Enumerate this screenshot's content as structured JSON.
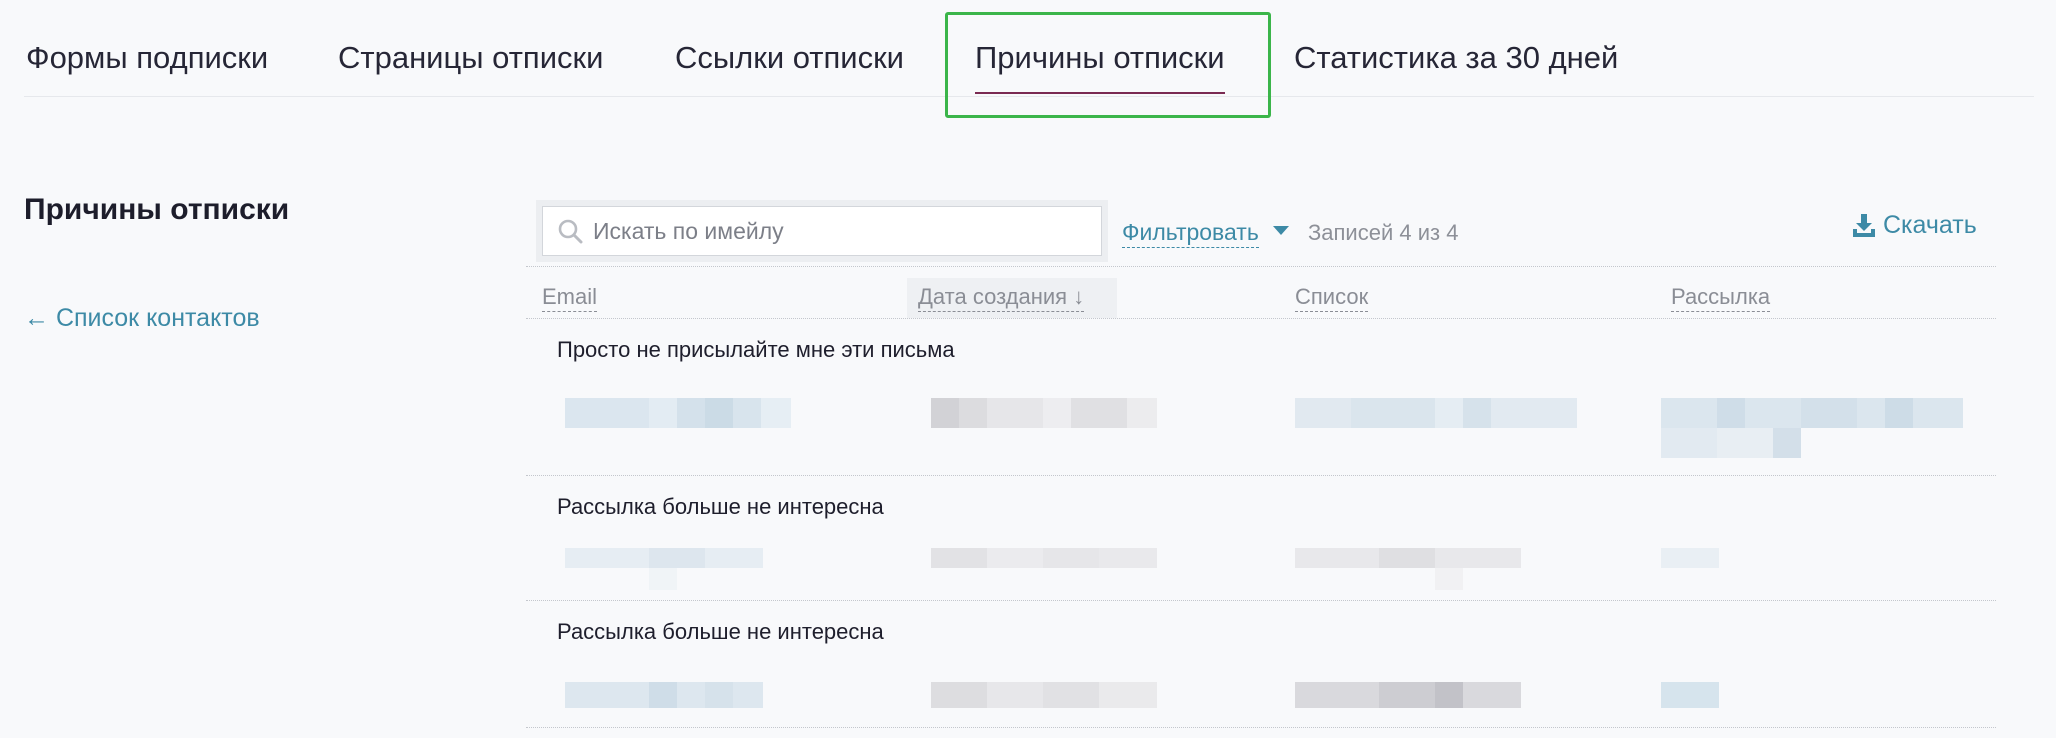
{
  "tabs": [
    {
      "label": "Формы подписки",
      "active": false
    },
    {
      "label": "Страницы отписки",
      "active": false
    },
    {
      "label": "Ссылки отписки",
      "active": false
    },
    {
      "label": "Причины отписки",
      "active": true
    },
    {
      "label": "Статистика за 30 дней",
      "active": false
    }
  ],
  "page": {
    "title": "Причины отписки",
    "back_link": "← Список контактов"
  },
  "toolbar": {
    "search_placeholder": "Искать по имейлу",
    "filter_label": "Фильтровать",
    "records_text": "Записей 4 из 4",
    "download_label": "Скачать"
  },
  "table": {
    "columns": [
      "Email",
      "Дата создания ↓",
      "Список",
      "Рассылка"
    ],
    "rows": [
      {
        "reason": "Просто не присылайте мне эти письма"
      },
      {
        "reason": "Рассылка больше не интересна"
      },
      {
        "reason": "Рассылка больше не интересна"
      }
    ]
  },
  "colors": {
    "accent_link": "#3d8aa6",
    "active_tab_underline": "#7a2a52",
    "highlight_box": "#3bb54a",
    "background": "#f8f9fb"
  },
  "icons": [
    "search-icon",
    "filter-caret-icon",
    "download-icon"
  ]
}
